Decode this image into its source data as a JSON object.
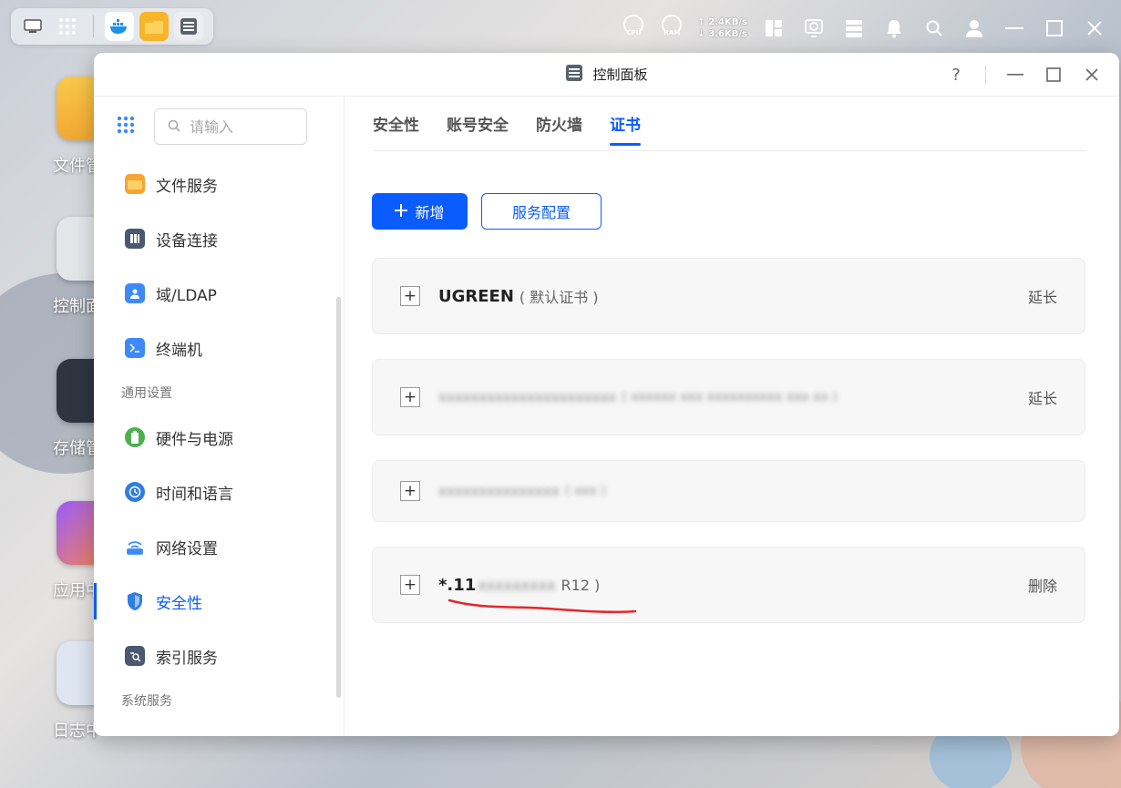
{
  "taskbar": {
    "apps": [
      "desktop-icon",
      "apps-grid-icon",
      "docker-icon",
      "files-icon",
      "control-panel-icon"
    ],
    "gauges": [
      {
        "label": "CPU"
      },
      {
        "label": "RAM"
      }
    ],
    "net_up": "2.4KB/s",
    "net_down": "3.6KB/s"
  },
  "desktop": {
    "labels": [
      "文件管",
      "控制面",
      "存储管",
      "应用中",
      "日志中"
    ]
  },
  "window": {
    "title": "控制面板",
    "help_label": "?"
  },
  "sidebar": {
    "search_placeholder": "请输入",
    "items_top": [
      {
        "label": "文件服务",
        "icon": "folder-icon",
        "color": "#f5a531"
      },
      {
        "label": "设备连接",
        "icon": "device-icon",
        "color": "#4a5870"
      },
      {
        "label": "域/LDAP",
        "icon": "ldap-icon",
        "color": "#3d8af7"
      },
      {
        "label": "终端机",
        "icon": "terminal-icon",
        "color": "#3d8af7"
      }
    ],
    "section_general": "通用设置",
    "items_general": [
      {
        "label": "硬件与电源",
        "icon": "battery-icon",
        "color": "#4caf50"
      },
      {
        "label": "时间和语言",
        "icon": "clock-icon",
        "color": "#2f7de1"
      },
      {
        "label": "网络设置",
        "icon": "network-icon",
        "color": "#3d8af7"
      },
      {
        "label": "安全性",
        "icon": "shield-icon",
        "color": "#2f7de1",
        "active": true
      },
      {
        "label": "索引服务",
        "icon": "index-icon",
        "color": "#4a5870"
      }
    ],
    "section_system": "系统服务"
  },
  "tabs": [
    {
      "label": "安全性"
    },
    {
      "label": "账号安全"
    },
    {
      "label": "防火墙"
    },
    {
      "label": "证书",
      "active": true
    }
  ],
  "actions": {
    "add_label": "新增",
    "config_label": "服务配置"
  },
  "certificates": [
    {
      "name": "UGREEN",
      "sub": "( 默认证书 )",
      "action": "延长",
      "blurred": false
    },
    {
      "name": "xxxxxxxxxxxxxxxxxxxxxx",
      "sub": "( xxxxxx xxx xxxxxxxxxx xxx xx )",
      "action": "延长",
      "blurred": true
    },
    {
      "name": "xxxxxxxxxxxxxxx",
      "sub": "( xxx )",
      "action": "",
      "blurred": true
    },
    {
      "name": "*.11",
      "name_hidden": "xxxxxxxxx",
      "sub": "R12 )",
      "action": "删除",
      "blurred": false
    }
  ],
  "colors": {
    "accent": "#0a5cff",
    "annotation": "#e8262b"
  }
}
